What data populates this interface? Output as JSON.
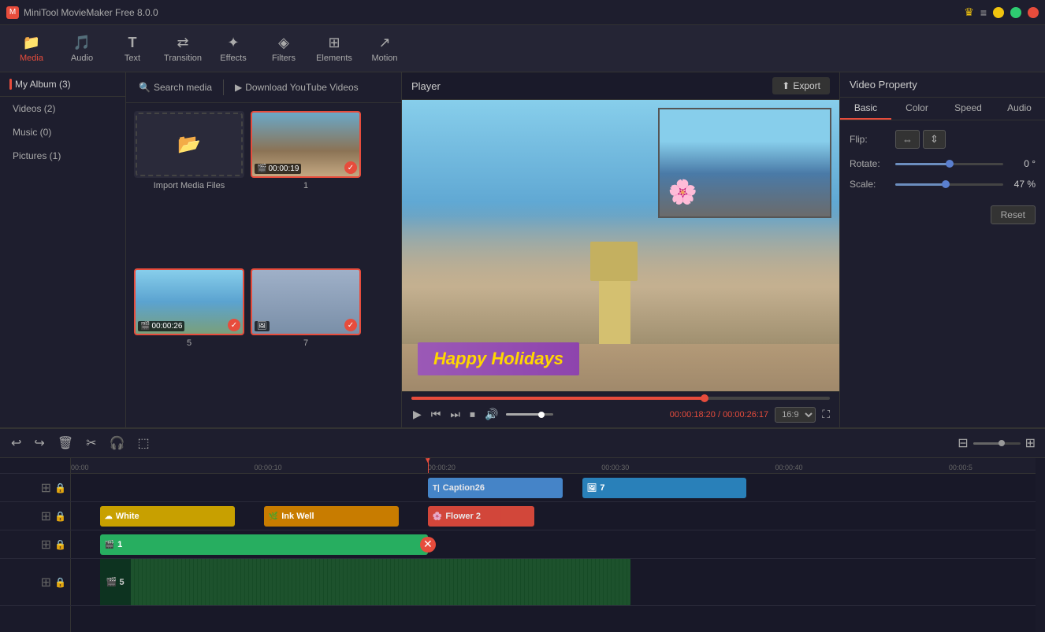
{
  "app": {
    "title": "MiniTool MovieMaker Free 8.0.0",
    "icon": "M"
  },
  "toolbar": {
    "items": [
      {
        "id": "media",
        "label": "Media",
        "icon": "📁",
        "active": true
      },
      {
        "id": "audio",
        "label": "Audio",
        "icon": "♪",
        "active": false
      },
      {
        "id": "text",
        "label": "Text",
        "icon": "T",
        "active": false
      },
      {
        "id": "transition",
        "label": "Transition",
        "icon": "⇄",
        "active": false
      },
      {
        "id": "effects",
        "label": "Effects",
        "icon": "✦",
        "active": false
      },
      {
        "id": "filters",
        "label": "Filters",
        "icon": "◈",
        "active": false
      },
      {
        "id": "elements",
        "label": "Elements",
        "icon": "⊞",
        "active": false
      },
      {
        "id": "motion",
        "label": "Motion",
        "icon": "↗",
        "active": false
      }
    ]
  },
  "left_panel": {
    "album_label": "My Album (3)",
    "menu_items": [
      {
        "label": "Videos (2)"
      },
      {
        "label": "Music (0)"
      },
      {
        "label": "Pictures (1)"
      }
    ]
  },
  "media_panel": {
    "search_label": "Search media",
    "yt_label": "Download YouTube Videos",
    "items": [
      {
        "id": "import",
        "type": "import",
        "label": "Import Media Files"
      },
      {
        "id": "1",
        "type": "video",
        "label": "1",
        "duration": "00:00:19",
        "selected": true
      },
      {
        "id": "5",
        "type": "video",
        "label": "5",
        "duration": "00:00:26",
        "selected": true
      },
      {
        "id": "7",
        "type": "picture",
        "label": "7",
        "selected": true
      }
    ]
  },
  "player": {
    "title": "Player",
    "export_label": "Export",
    "current_time": "00:00:18:20",
    "total_time": "00:00:26:17",
    "progress_pct": 70,
    "volume_pct": 75,
    "aspect_ratio": "16:9",
    "preview_text": "Happy Holidays"
  },
  "video_property": {
    "title": "Video Property",
    "tabs": [
      {
        "label": "Basic",
        "active": true
      },
      {
        "label": "Color",
        "active": false
      },
      {
        "label": "Speed",
        "active": false
      },
      {
        "label": "Audio",
        "active": false
      }
    ],
    "flip_label": "Flip:",
    "rotate_label": "Rotate:",
    "scale_label": "Scale:",
    "rotate_value": "0 °",
    "scale_value": "47 %",
    "rotate_pct": 50,
    "scale_pct": 47,
    "reset_label": "Reset"
  },
  "timeline": {
    "time_marks": [
      "00:00",
      "00:00:10",
      "00:00:20",
      "00:00:30",
      "00:00:40",
      "00:00:5"
    ],
    "playhead_pct": 37,
    "clips": {
      "overlay_row": [
        {
          "label": "Caption26",
          "type": "caption",
          "left_pct": 37,
          "width_pct": 15
        },
        {
          "label": "7",
          "type": "media7",
          "left_pct": 55,
          "width_pct": 18
        }
      ],
      "sticker_row": [
        {
          "label": "White",
          "type": "white",
          "left_pct": 3,
          "width_pct": 15
        },
        {
          "label": "Ink Well",
          "type": "inkwell",
          "left_pct": 20,
          "width_pct": 15
        },
        {
          "label": "Flower 2",
          "type": "flower2",
          "left_pct": 37,
          "width_pct": 12
        }
      ],
      "video_row": [
        {
          "label": "1",
          "type": "video1",
          "left_pct": 3,
          "width_pct": 36,
          "has_cut": true
        }
      ]
    }
  }
}
